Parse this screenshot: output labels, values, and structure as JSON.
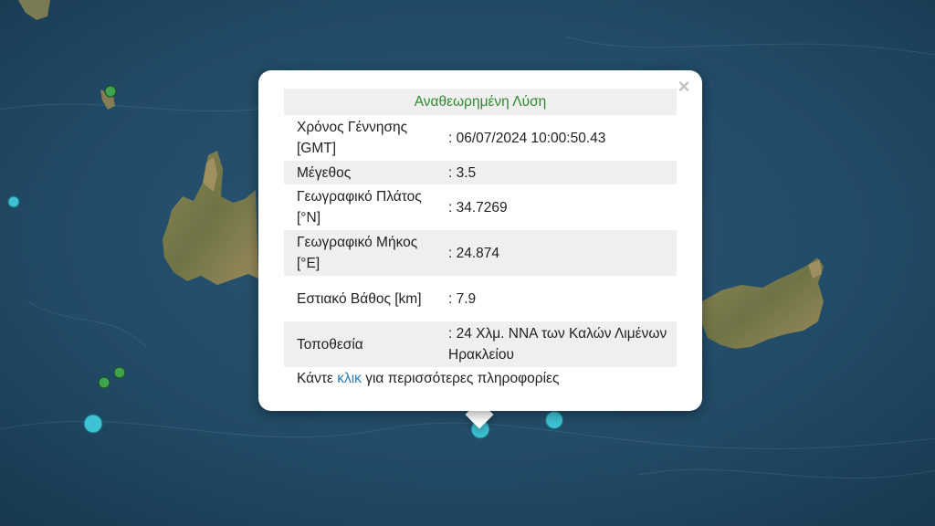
{
  "popup": {
    "header": "Αναθεωρημένη Λύση",
    "close_symbol": "×",
    "rows": [
      {
        "label": "Χρόνος Γέννησης [GMT]",
        "value": ": 06/07/2024 10:00:50.43"
      },
      {
        "label": "Μέγεθος",
        "value": ": 3.5"
      },
      {
        "label": "Γεωγραφικό Πλάτος [°N]",
        "value": ": 34.7269"
      },
      {
        "label": "Γεωγραφικό Μήκος [°E]",
        "value": ": 24.874"
      },
      {
        "label": "Εστιακό Βάθος [km]",
        "value": ": 7.9"
      },
      {
        "label": "Τοποθεσία",
        "value": ": 24 Χλμ. ΝΝΑ των Καλών Λιμένων Ηρακλείου"
      }
    ],
    "footer": {
      "prefix": "Κάντε ",
      "link": "κλικ",
      "suffix": " για περισσότερες πληροφορίες"
    }
  },
  "map": {
    "layer": "satellite imagery",
    "marker_colors": {
      "cyan": "#3ec1d3",
      "green": "#3fa34d"
    }
  }
}
